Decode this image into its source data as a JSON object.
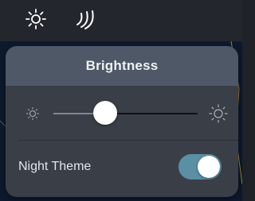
{
  "toolbar": {
    "icons": [
      "sun-icon",
      "signal-waves-icon"
    ]
  },
  "popover": {
    "title": "Brightness",
    "brightness": {
      "value": 0.36,
      "min_icon": "sun-small-icon",
      "max_icon": "sun-large-icon"
    },
    "night_theme": {
      "label": "Night Theme",
      "enabled": true
    }
  },
  "colors": {
    "header_bg": "#4e5866",
    "panel_bg": "#3a3f47",
    "toggle_on": "#5b8fa3",
    "toolbar_bg": "#23272d"
  }
}
